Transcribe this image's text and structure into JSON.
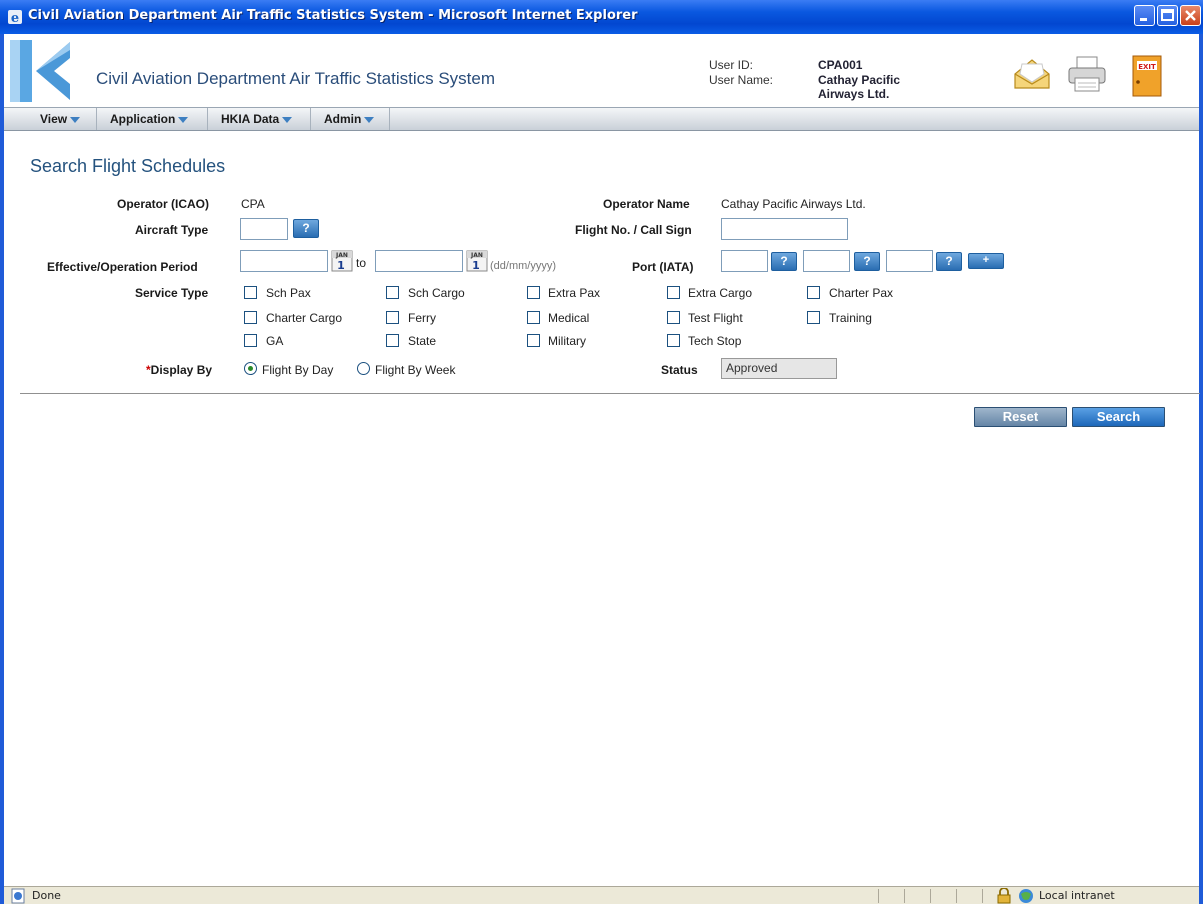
{
  "window": {
    "title": "Civil Aviation Department Air Traffic Statistics System - Microsoft Internet Explorer"
  },
  "header": {
    "app_title": "Civil Aviation Department Air Traffic Statistics System",
    "user_id_label": "User ID:",
    "user_id": "CPA001",
    "user_name_label": "User Name:",
    "user_name_line1": "Cathay Pacific",
    "user_name_line2": "Airways Ltd.",
    "exit_label": "EXIT"
  },
  "menu": [
    {
      "label": "View"
    },
    {
      "label": "Application"
    },
    {
      "label": "HKIA Data"
    },
    {
      "label": "Admin"
    }
  ],
  "form": {
    "title": "Search Flight Schedules",
    "operator_icao_label": "Operator (ICAO)",
    "operator_icao_value": "CPA",
    "operator_name_label": "Operator Name",
    "operator_name_value": "Cathay Pacific Airways Ltd.",
    "aircraft_type_label": "Aircraft Type",
    "flight_no_label": "Flight No. / Call Sign",
    "period_label": "Effective/Operation Period",
    "to_label": "to",
    "date_hint": "(dd/mm/yyyy)",
    "port_label": "Port (IATA)",
    "lookup_label": "?",
    "add_port_label": "+",
    "calendar_month": "JAN",
    "calendar_day": "1",
    "service_type_label": "Service Type",
    "service_types": [
      "Sch Pax",
      "Sch Cargo",
      "Extra Pax",
      "Extra Cargo",
      "Charter Pax",
      "Charter Cargo",
      "Ferry",
      "Medical",
      "Test Flight",
      "Training",
      "GA",
      "State",
      "Military",
      "Tech Stop"
    ],
    "required_mark": "*",
    "display_by_label": "Display By",
    "display_options": [
      "Flight By Day",
      "Flight By Week"
    ],
    "display_selected": "Flight By Day",
    "status_label": "Status",
    "status_value": "Approved",
    "reset_label": "Reset",
    "search_label": "Search"
  },
  "statusbar": {
    "text": "Done",
    "zone": "Local intranet"
  },
  "colors": {
    "title_blue": "#24527e",
    "button_blue": "#1d67b9",
    "xp_titlebar": "#0a58e0"
  }
}
